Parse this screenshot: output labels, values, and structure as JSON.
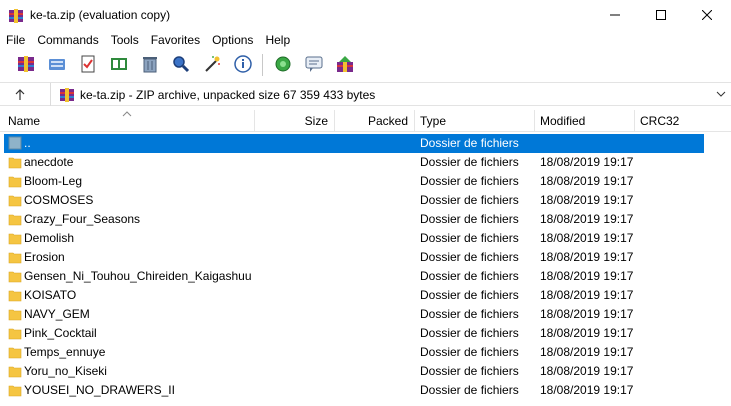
{
  "window": {
    "title": "ke-ta.zip (evaluation copy)"
  },
  "menu": [
    "File",
    "Commands",
    "Tools",
    "Favorites",
    "Options",
    "Help"
  ],
  "toolbar": {
    "icons": [
      "add-icon",
      "extract-icon",
      "test-icon",
      "view-icon",
      "delete-icon",
      "find-icon",
      "wizard-icon",
      "info-icon",
      "virusscan-icon",
      "comment-icon",
      "sfx-icon"
    ]
  },
  "address": {
    "text": "ke-ta.zip - ZIP archive, unpacked size 67 359 433 bytes"
  },
  "columns": {
    "name": "Name",
    "size": "Size",
    "packed": "Packed",
    "type": "Type",
    "modified": "Modified",
    "crc": "CRC32"
  },
  "rows": [
    {
      "name": "..",
      "type": "Dossier de fichiers",
      "modified": ""
    },
    {
      "name": "anecdote",
      "type": "Dossier de fichiers",
      "modified": "18/08/2019 19:17"
    },
    {
      "name": "Bloom-Leg",
      "type": "Dossier de fichiers",
      "modified": "18/08/2019 19:17"
    },
    {
      "name": "COSMOSES",
      "type": "Dossier de fichiers",
      "modified": "18/08/2019 19:17"
    },
    {
      "name": "Crazy_Four_Seasons",
      "type": "Dossier de fichiers",
      "modified": "18/08/2019 19:17"
    },
    {
      "name": "Demolish",
      "type": "Dossier de fichiers",
      "modified": "18/08/2019 19:17"
    },
    {
      "name": "Erosion",
      "type": "Dossier de fichiers",
      "modified": "18/08/2019 19:17"
    },
    {
      "name": "Gensen_Ni_Touhou_Chireiden_Kaigashuu",
      "type": "Dossier de fichiers",
      "modified": "18/08/2019 19:17"
    },
    {
      "name": "KOISATO",
      "type": "Dossier de fichiers",
      "modified": "18/08/2019 19:17"
    },
    {
      "name": "NAVY_GEM",
      "type": "Dossier de fichiers",
      "modified": "18/08/2019 19:17"
    },
    {
      "name": "Pink_Cocktail",
      "type": "Dossier de fichiers",
      "modified": "18/08/2019 19:17"
    },
    {
      "name": "Temps_ennuye",
      "type": "Dossier de fichiers",
      "modified": "18/08/2019 19:17"
    },
    {
      "name": "Yoru_no_Kiseki",
      "type": "Dossier de fichiers",
      "modified": "18/08/2019 19:17"
    },
    {
      "name": "YOUSEI_NO_DRAWERS_II",
      "type": "Dossier de fichiers",
      "modified": "18/08/2019 19:17"
    }
  ],
  "colors": {
    "selection": "#0078d7",
    "folder": "#f5c542"
  }
}
